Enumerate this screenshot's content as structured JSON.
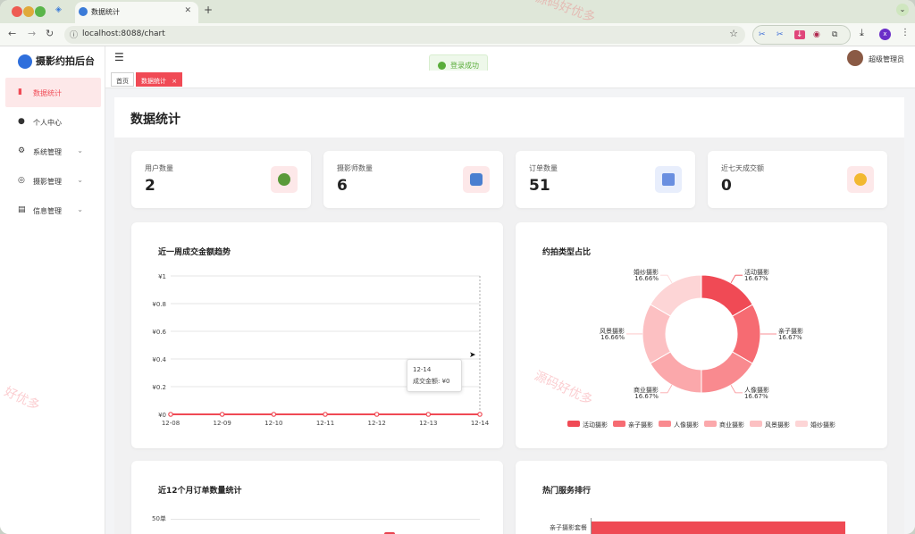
{
  "browser": {
    "tab_title": "数据统计",
    "url": "localhost:8088/chart"
  },
  "app": {
    "title": "摄影约拍后台"
  },
  "sidebar": {
    "items": [
      {
        "label": "数据统计"
      },
      {
        "label": "个人中心"
      },
      {
        "label": "系统管理"
      },
      {
        "label": "摄影管理"
      },
      {
        "label": "信息管理"
      }
    ]
  },
  "header": {
    "toast": "登录成功",
    "user": "超级管理员"
  },
  "tags": {
    "home": "首页",
    "current": "数据统计",
    "close": "×"
  },
  "page": {
    "title": "数据统计"
  },
  "stats": [
    {
      "label": "用户数量",
      "value": "2"
    },
    {
      "label": "摄影师数量",
      "value": "6"
    },
    {
      "label": "订单数量",
      "value": "51"
    },
    {
      "label": "近七天成交额",
      "value": "0"
    }
  ],
  "tooltip": {
    "date": "12-14",
    "text": "成交金额: ¥0"
  },
  "watermarks": {
    "a": "源码好优多",
    "b": "好优多"
  },
  "colors": {
    "accent": "#f04a55"
  },
  "chart_data": [
    {
      "type": "line",
      "title": "近一周成交金额趋势",
      "x": [
        "12-08",
        "12-09",
        "12-10",
        "12-11",
        "12-12",
        "12-13",
        "12-14"
      ],
      "values": [
        0,
        0,
        0,
        0,
        0,
        0,
        0
      ],
      "ylim": [
        0,
        1
      ],
      "yticks": [
        "¥0",
        "¥0.2",
        "¥0.4",
        "¥0.6",
        "¥0.8",
        "¥1"
      ],
      "color": "#f04a55"
    },
    {
      "type": "pie",
      "title": "约拍类型占比",
      "donut": true,
      "slices": [
        {
          "name": "活动摄影",
          "value": 16.67,
          "label": "16.67%",
          "color": "#f04a55"
        },
        {
          "name": "亲子摄影",
          "value": 16.67,
          "label": "16.67%",
          "color": "#f66b72"
        },
        {
          "name": "人像摄影",
          "value": 16.67,
          "label": "16.67%",
          "color": "#f98a8f"
        },
        {
          "name": "商业摄影",
          "value": 16.67,
          "label": "16.67%",
          "color": "#fba8ab"
        },
        {
          "name": "风景摄影",
          "value": 16.66,
          "label": "16.66%",
          "color": "#fcc0c2"
        },
        {
          "name": "婚纱摄影",
          "value": 16.66,
          "label": "16.66%",
          "color": "#fdd5d6"
        }
      ]
    },
    {
      "type": "bar",
      "title": "近12个月订单数量统计",
      "ytick_top": "50单",
      "visible_bar_color": "#e8434f"
    },
    {
      "type": "bar",
      "title": "热门服务排行",
      "categories": [
        "亲子摄影套餐"
      ],
      "color": "#ef4a54"
    }
  ]
}
